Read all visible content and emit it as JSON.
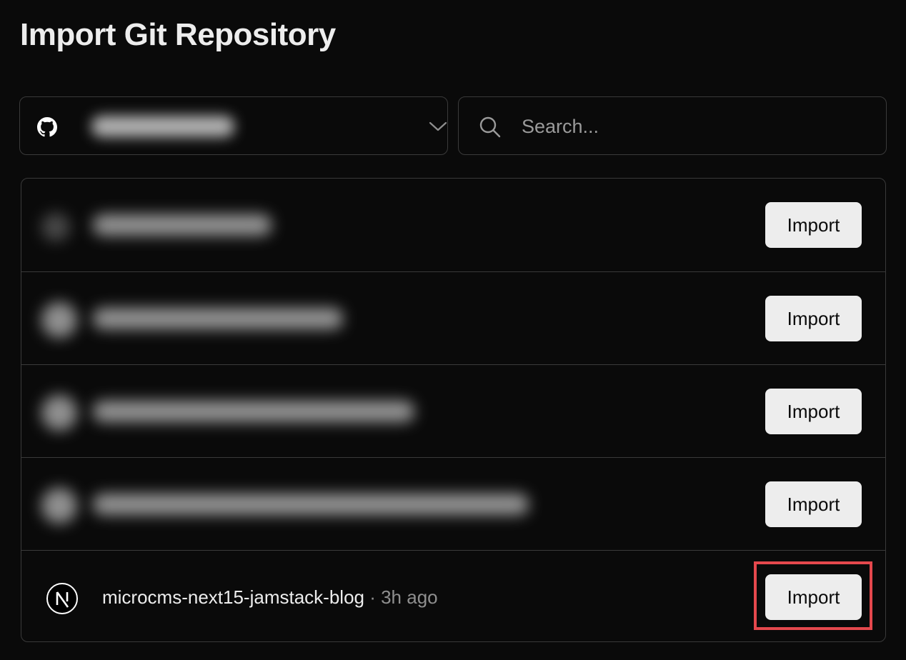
{
  "header": {
    "title": "Import Git Repository"
  },
  "scope_select": {
    "provider_icon": "github-icon",
    "selected_label": "••••••••",
    "dropdown_icon": "chevron-down-icon"
  },
  "search": {
    "placeholder": "Search...",
    "value": "",
    "icon": "search-icon"
  },
  "repositories": [
    {
      "name": "••••••••••",
      "blurred": true,
      "action_label": "Import"
    },
    {
      "name": "•••••••••••",
      "blurred": true,
      "action_label": "Import"
    },
    {
      "name": "•••••••••••••",
      "blurred": true,
      "action_label": "Import"
    },
    {
      "name": "••••••••••••••",
      "blurred": true,
      "action_label": "Import"
    },
    {
      "name": "microcms-next15-jamstack-blog",
      "meta": "· 3h ago",
      "icon": "nextjs-icon",
      "blurred": false,
      "action_label": "Import"
    }
  ],
  "colors": {
    "background": "#0a0a0a",
    "border": "#3a3a3a",
    "button_bg": "#ededed",
    "highlight": "#e5484d"
  }
}
